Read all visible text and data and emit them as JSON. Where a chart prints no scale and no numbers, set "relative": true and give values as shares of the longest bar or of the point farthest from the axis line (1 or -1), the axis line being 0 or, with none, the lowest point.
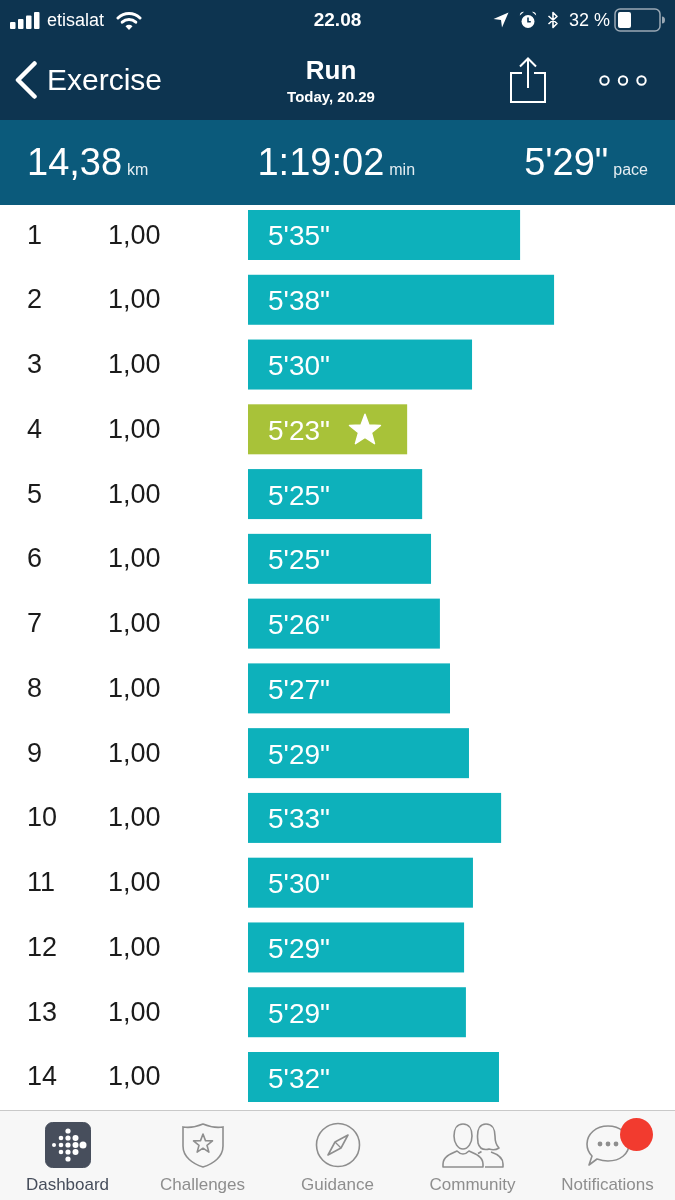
{
  "status_bar": {
    "carrier": "etisalat",
    "time": "22.08",
    "battery": "32 %"
  },
  "header": {
    "back": "Exercise",
    "title": "Run",
    "subtitle": "Today, 20.29"
  },
  "summary": [
    {
      "value": "14,38",
      "unit": "km"
    },
    {
      "value": "1:19:02",
      "unit": "min"
    },
    {
      "value": "5'29\"",
      "unit": "pace"
    }
  ],
  "splits": {
    "rows": [
      {
        "distance": "1,00",
        "pace": "5'35\"",
        "best": false
      },
      {
        "distance": "1,00",
        "pace": "5'38\"",
        "best": false
      },
      {
        "distance": "1,00",
        "pace": "5'30\"",
        "best": false
      },
      {
        "distance": "1,00",
        "pace": "5'23\"",
        "best": true
      },
      {
        "distance": "1,00",
        "pace": "5'25\"",
        "best": false
      },
      {
        "distance": "1,00",
        "pace": "5'25\"",
        "best": false
      },
      {
        "distance": "1,00",
        "pace": "5'26\"",
        "best": false
      },
      {
        "distance": "1,00",
        "pace": "5'27\"",
        "best": false
      },
      {
        "distance": "1,00",
        "pace": "5'29\"",
        "best": false
      },
      {
        "distance": "1,00",
        "pace": "5'33\"",
        "best": false
      },
      {
        "distance": "1,00",
        "pace": "5'30\"",
        "best": false
      },
      {
        "distance": "1,00",
        "pace": "5'29\"",
        "best": false
      },
      {
        "distance": "1,00",
        "pace": "5'29\"",
        "best": false
      },
      {
        "distance": "1,00",
        "pace": "5'32\"",
        "best": false
      }
    ],
    "chart_data": {
      "type": "bar",
      "orientation": "horizontal",
      "relative": true,
      "categories": [
        "1",
        "2",
        "3",
        "4",
        "5",
        "6",
        "7",
        "8",
        "9",
        "10",
        "11",
        "12",
        "13",
        "14"
      ],
      "values": [
        0.889,
        1,
        0.732,
        0.52,
        0.569,
        0.598,
        0.627,
        0.66,
        0.722,
        0.827,
        0.735,
        0.706,
        0.712,
        0.82
      ]
    }
  },
  "tab_bar": [
    {
      "label": "Dashboard",
      "kind": "dots",
      "selected": true,
      "unread": false
    },
    {
      "label": "Challenges",
      "kind": "shield",
      "selected": false,
      "unread": false
    },
    {
      "label": "Guidance",
      "kind": "compass",
      "selected": false,
      "unread": false
    },
    {
      "label": "Community",
      "kind": "people",
      "selected": false,
      "unread": false
    },
    {
      "label": "Notifications",
      "kind": "chat",
      "selected": false,
      "unread": true
    }
  ]
}
